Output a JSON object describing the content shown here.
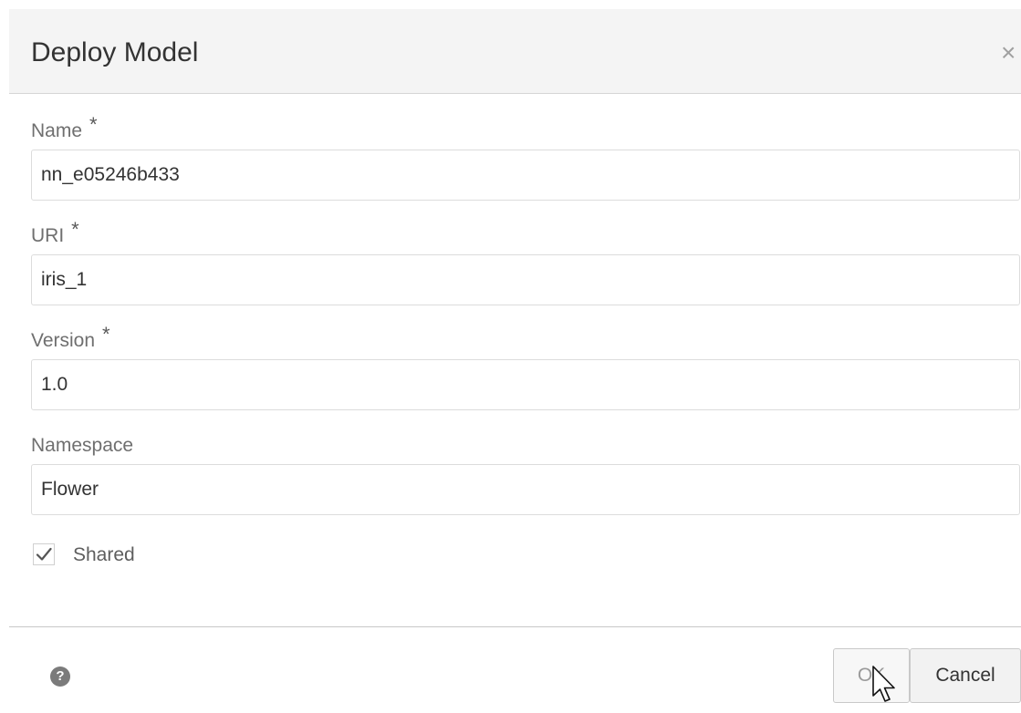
{
  "dialog": {
    "title": "Deploy Model",
    "close_glyph": "×",
    "close_icon": "close-icon"
  },
  "form": {
    "required_marker": "*",
    "name": {
      "label": "Name",
      "value": "nn_e05246b433",
      "required": true
    },
    "uri": {
      "label": "URI",
      "value": "iris_1",
      "required": true
    },
    "version": {
      "label": "Version",
      "value": "1.0",
      "required": true
    },
    "namespace": {
      "label": "Namespace",
      "value": "Flower",
      "required": false
    },
    "shared": {
      "label": "Shared",
      "checked": true,
      "icon": "checkmark-icon"
    }
  },
  "footer": {
    "help_glyph": "?",
    "help_icon": "question-circle-icon",
    "ok_label": "OK",
    "cancel_label": "Cancel"
  },
  "colors": {
    "header_background": "#f4f4f4",
    "label_text": "#6f6f6f",
    "input_border": "#dcdcdc",
    "ok_text_disabled": "#9a9a9a",
    "help_icon": "#7b7b7b"
  }
}
